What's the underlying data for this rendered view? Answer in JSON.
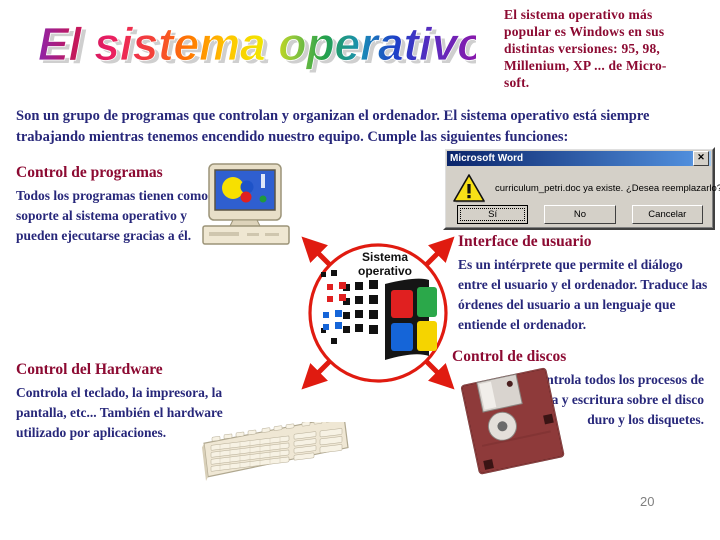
{
  "slide": {
    "page_number": "20",
    "background_color": "#ffffff",
    "heading_color": "#8C0A32",
    "body_color": "#27277A"
  },
  "title": {
    "text": "El sistema operativo",
    "style": "wordart-rainbow",
    "letters": [
      {
        "ch": "E",
        "color": "#8E24AA"
      },
      {
        "ch": "l",
        "color": "#9C27B0"
      },
      {
        "ch": " ",
        "color": "#C2185B"
      },
      {
        "ch": "s",
        "color": "#E91E63"
      },
      {
        "ch": "i",
        "color": "#F4394A"
      },
      {
        "ch": "s",
        "color": "#F44336"
      },
      {
        "ch": "t",
        "color": "#FF5722"
      },
      {
        "ch": "e",
        "color": "#FF7A00"
      },
      {
        "ch": "m",
        "color": "#FFA000"
      },
      {
        "ch": "a",
        "color": "#FFD400"
      },
      {
        "ch": " ",
        "color": "#EFE000"
      },
      {
        "ch": "o",
        "color": "#D6DF1E"
      },
      {
        "ch": "p",
        "color": "#7CB342"
      },
      {
        "ch": "e",
        "color": "#29A84A"
      },
      {
        "ch": "r",
        "color": "#00A6A0"
      },
      {
        "ch": "a",
        "color": "#1565C0"
      },
      {
        "ch": "t",
        "color": "#2038C8"
      },
      {
        "ch": "i",
        "color": "#3F2FC4"
      },
      {
        "ch": "v",
        "color": "#6A1BB0"
      },
      {
        "ch": "o",
        "color": "#8E1AA8"
      }
    ]
  },
  "topright_note": {
    "lines": [
      "El sistema operativo más",
      "popular es Windows en sus",
      "distintas versiones: 95, 98,",
      "Millenium, XP ... de Micro-",
      "soft."
    ]
  },
  "intro": {
    "text": "Son un grupo de programas que controlan y organizan el ordenador. El sistema operativo está siempre trabajando mientras tenemos encendido nuestro equipo. Cumple las siguientes funciones:"
  },
  "sections": [
    {
      "id": "programas",
      "heading": "Control de programas",
      "body": "Todos los programas tienen como soporte al sistema operativo y pueden ejecutarse gracias a él."
    },
    {
      "id": "hardware",
      "heading": "Control del Hardware",
      "body": "Controla el teclado, la impresora, la pantalla, etc... También el hardware utilizado por aplicaciones."
    },
    {
      "id": "interface",
      "heading": "Interface de usuario",
      "body": "Es un intérprete que permite el diálogo entre el usuario y el ordenador. Traduce las órdenes del usuario a un lenguaje que entiende el ordenador."
    },
    {
      "id": "discos",
      "heading": "Control de discos",
      "body": "Controla todos los procesos de lectura y escritura sobre el disco duro y los disquetes."
    }
  ],
  "dialog": {
    "title": "Microsoft Word",
    "close_label": "✕",
    "icon": "warning-icon",
    "message": "curriculum_petri.doc ya existe. ¿Desea reemplazarlo?",
    "buttons": [
      {
        "label": "Sí",
        "default": true
      },
      {
        "label": "No",
        "default": false
      },
      {
        "label": "Cancelar",
        "default": false
      }
    ]
  },
  "center_graphic": {
    "caption_line1": "Sistema",
    "caption_line2": "operativo",
    "circle_color": "#E01B10",
    "flag_colors": [
      "#E02020",
      "#2BA84A",
      "#1565D8",
      "#F5D400"
    ]
  },
  "clipart": [
    {
      "name": "desktop-computer-monitor"
    },
    {
      "name": "windows-logo-circle"
    },
    {
      "name": "floppy-disk"
    },
    {
      "name": "computer-keyboard"
    }
  ]
}
